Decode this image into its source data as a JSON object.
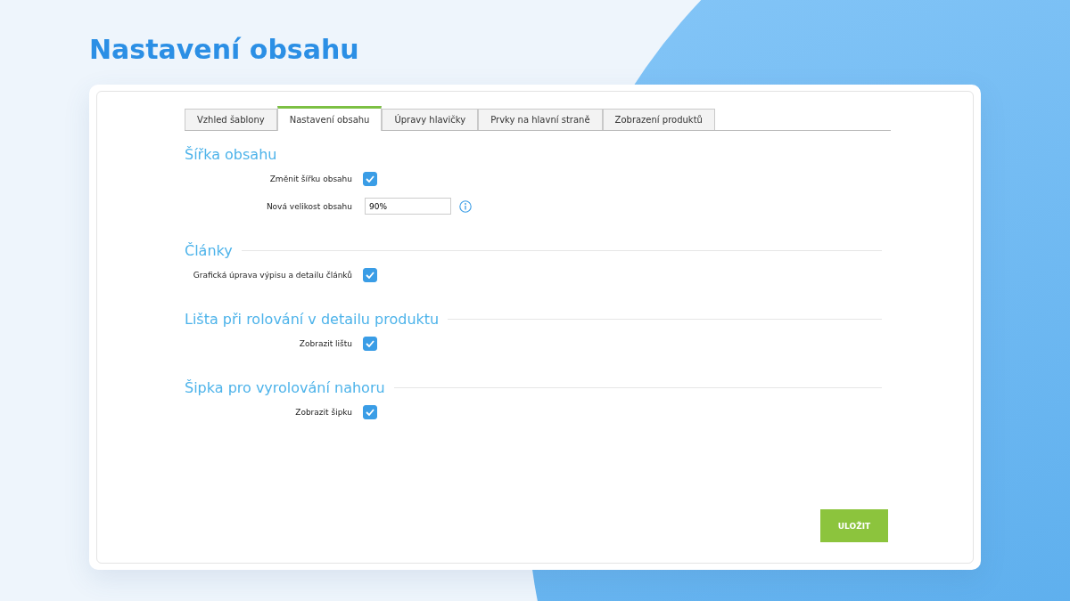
{
  "page_title": "Nastavení obsahu",
  "tabs": [
    {
      "label": "Vzhled šablony",
      "selected": false
    },
    {
      "label": "Nastavení obsahu",
      "selected": true
    },
    {
      "label": "Úpravy hlavičky",
      "selected": false
    },
    {
      "label": "Prvky na hlavní straně",
      "selected": false
    },
    {
      "label": "Zobrazení produktů",
      "selected": false
    }
  ],
  "sections": [
    {
      "heading": "Šířka obsahu",
      "fields": [
        {
          "kind": "checkbox",
          "label": "Změnit šířku obsahu",
          "checked": true
        },
        {
          "kind": "text",
          "label": "Nová velikost obsahu",
          "value": "90%"
        }
      ]
    },
    {
      "heading": "Články",
      "fields": [
        {
          "kind": "checkbox",
          "label": "Grafická úprava výpisu a detailu článků",
          "checked": true
        }
      ]
    },
    {
      "heading": "Lišta při rolování v detailu produktu",
      "fields": [
        {
          "kind": "checkbox",
          "label": "Zobrazit lištu",
          "checked": true
        }
      ]
    },
    {
      "heading": "Šipka pro vyrolování nahoru",
      "fields": [
        {
          "kind": "checkbox",
          "label": "Zobrazit šipku",
          "checked": true
        }
      ]
    }
  ],
  "save_button": "ULOŽIT"
}
